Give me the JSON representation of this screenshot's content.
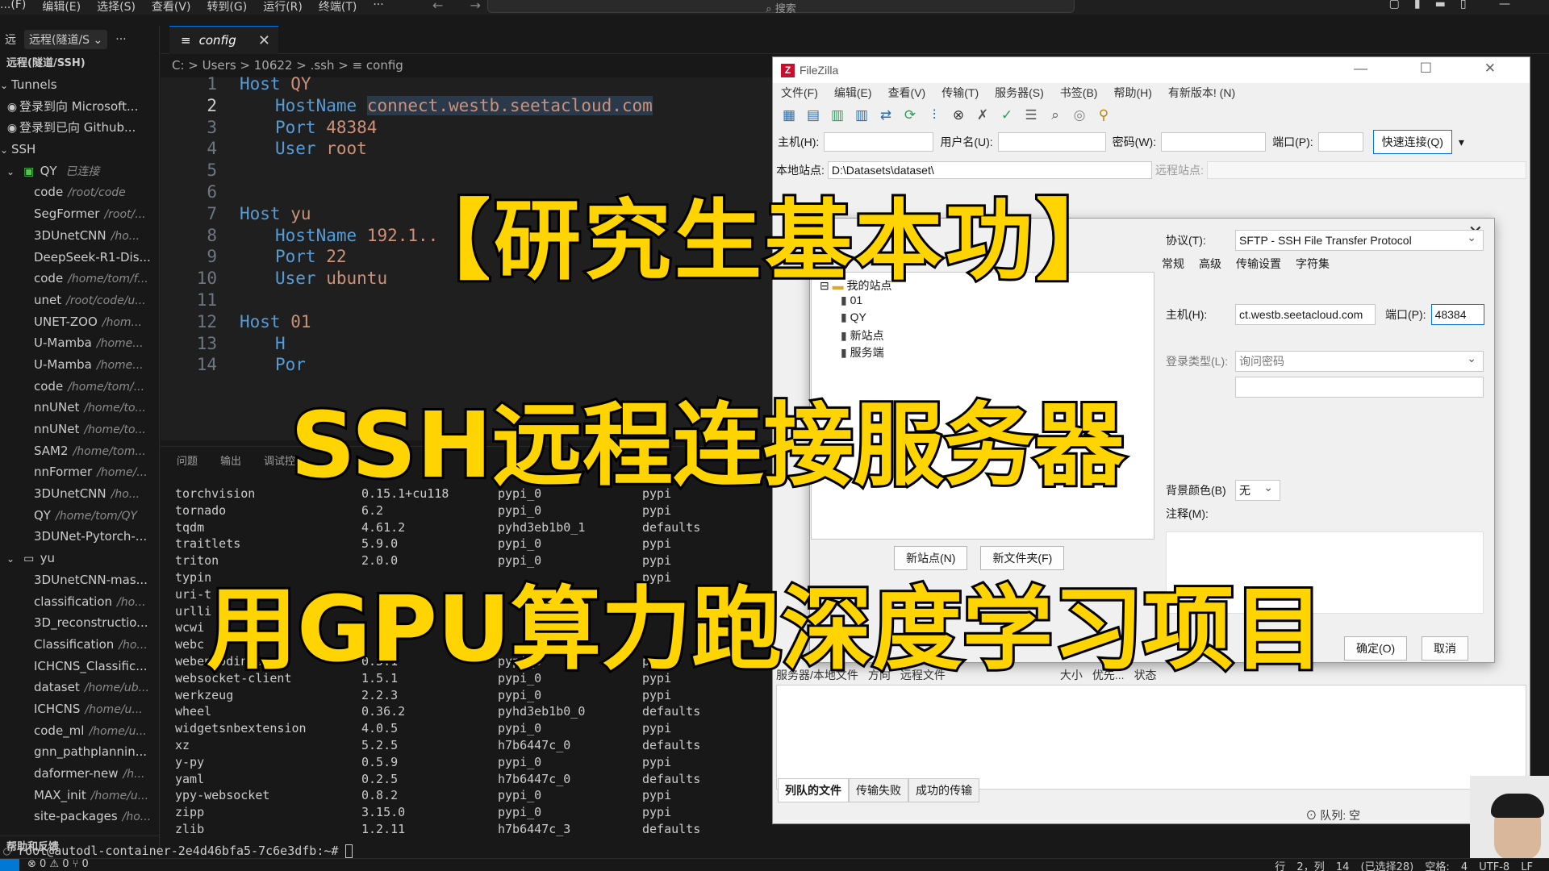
{
  "vscode": {
    "menu": [
      "...(F)",
      "编辑(E)",
      "选择(S)",
      "查看(V)",
      "转到(G)",
      "运行(R)",
      "终端(T)",
      "···"
    ],
    "search_placeholder": "⌕ 搜索",
    "sidebar_header_short": "远",
    "sidebar_dropdown": "远程(隧道/S ⌄",
    "sidebar_more": "···",
    "section_title": "远程(隧道/SSH)",
    "tunnels_label": "Tunnels",
    "tunnel_items": [
      "登录到向 Microsoft...",
      "登录到已向 Github..."
    ],
    "ssh_label": "SSH",
    "host_qy": {
      "name": "QY",
      "status": "已连接"
    },
    "qy_items": [
      {
        "name": "code",
        "path": "/root/code"
      },
      {
        "name": "SegFormer",
        "path": "/root/..."
      },
      {
        "name": "3DUnetCNN",
        "path": "/ho..."
      },
      {
        "name": "DeepSeek-R1-Dis...",
        "path": ""
      },
      {
        "name": "code",
        "path": "/home/tom/f..."
      },
      {
        "name": "unet",
        "path": "/root/code/u..."
      },
      {
        "name": "UNET-ZOO",
        "path": "/hom..."
      },
      {
        "name": "U-Mamba",
        "path": "/home..."
      },
      {
        "name": "U-Mamba",
        "path": "/home..."
      },
      {
        "name": "code",
        "path": "/home/tom/..."
      },
      {
        "name": "nnUNet",
        "path": "/home/to..."
      },
      {
        "name": "nnUNet",
        "path": "/home/to..."
      },
      {
        "name": "SAM2",
        "path": "/home/tom..."
      },
      {
        "name": "nnFormer",
        "path": "/home/..."
      },
      {
        "name": "3DUnetCNN",
        "path": "/ho..."
      },
      {
        "name": "QY",
        "path": "/home/tom/QY"
      },
      {
        "name": "3DUNet-Pytorch-...",
        "path": ""
      }
    ],
    "host_yu": {
      "name": "yu"
    },
    "yu_items": [
      {
        "name": "3DUnetCNN-mas...",
        "path": ""
      },
      {
        "name": "classification",
        "path": "/ho..."
      },
      {
        "name": "3D_reconstructio...",
        "path": ""
      },
      {
        "name": "Classification",
        "path": "/ho..."
      },
      {
        "name": "ICHCNS_Classific...",
        "path": ""
      },
      {
        "name": "dataset",
        "path": "/home/ub..."
      },
      {
        "name": "ICHCNS",
        "path": "/home/u..."
      },
      {
        "name": "code_ml",
        "path": "/home/u..."
      },
      {
        "name": "gnn_pathplannin...",
        "path": ""
      },
      {
        "name": "daformer-new",
        "path": "/h..."
      },
      {
        "name": "MAX_init",
        "path": "/home/u..."
      },
      {
        "name": "site-packages",
        "path": "/ho..."
      }
    ],
    "sidebar_footer": "帮助和反馈",
    "tab_label": "config",
    "breadcrumb": "C: > Users > 10622 > .ssh > ≡ config",
    "code_lines": [
      {
        "n": "1",
        "key": "Host",
        "val": "QY",
        "indent": false
      },
      {
        "n": "2",
        "key": "HostName",
        "val": "connect.westb.seetacloud.com",
        "indent": true
      },
      {
        "n": "3",
        "key": "Port",
        "val": "48384",
        "indent": true
      },
      {
        "n": "4",
        "key": "User",
        "val": "root",
        "indent": true
      },
      {
        "n": "5",
        "key": "",
        "val": "",
        "indent": false
      },
      {
        "n": "6",
        "key": "",
        "val": "",
        "indent": false
      },
      {
        "n": "7",
        "key": "Host",
        "val": "yu",
        "indent": false
      },
      {
        "n": "8",
        "key": "HostName",
        "val": "192.1..",
        "indent": true
      },
      {
        "n": "9",
        "key": "Port",
        "val": "22",
        "indent": true
      },
      {
        "n": "10",
        "key": "User",
        "val": "ubuntu",
        "indent": true
      },
      {
        "n": "11",
        "key": "",
        "val": "",
        "indent": false
      },
      {
        "n": "12",
        "key": "Host",
        "val": "01",
        "indent": false
      },
      {
        "n": "13",
        "key": "H",
        "val": "",
        "indent": true
      },
      {
        "n": "14",
        "key": "Por",
        "val": "",
        "indent": true
      }
    ],
    "panel_tabs": [
      "问题",
      "输出",
      "调试控"
    ],
    "terminal_rows": [
      [
        "torchvision",
        "0.15.1+cu118",
        "pypi_0",
        "pypi"
      ],
      [
        "tornado",
        "6.2",
        "pypi_0",
        "pypi"
      ],
      [
        "tqdm",
        "4.61.2",
        "pyhd3eb1b0_1",
        "defaults"
      ],
      [
        "traitlets",
        "5.9.0",
        "pypi_0",
        "pypi"
      ],
      [
        "triton",
        "2.0.0",
        "pypi_0",
        "pypi"
      ],
      [
        "typin",
        "",
        "",
        "pypi"
      ],
      [
        "uri-t",
        "",
        "",
        ""
      ],
      [
        "urlli",
        "",
        "",
        ""
      ],
      [
        "wcwi",
        "",
        "",
        ""
      ],
      [
        "webc",
        "",
        "",
        ""
      ],
      [
        "webencodings",
        "0.5.1",
        "pypi_0",
        "pypi"
      ],
      [
        "websocket-client",
        "1.5.1",
        "pypi_0",
        "pypi"
      ],
      [
        "werkzeug",
        "2.2.3",
        "pypi_0",
        "pypi"
      ],
      [
        "wheel",
        "0.36.2",
        "pyhd3eb1b0_0",
        "defaults"
      ],
      [
        "widgetsnbextension",
        "4.0.5",
        "pypi_0",
        "pypi"
      ],
      [
        "xz",
        "5.2.5",
        "h7b6447c_0",
        "defaults"
      ],
      [
        "y-py",
        "0.5.9",
        "pypi_0",
        "pypi"
      ],
      [
        "yaml",
        "0.2.5",
        "h7b6447c_0",
        "defaults"
      ],
      [
        "ypy-websocket",
        "0.8.2",
        "pypi_0",
        "pypi"
      ],
      [
        "zipp",
        "3.15.0",
        "pypi_0",
        "pypi"
      ],
      [
        "zlib",
        "1.2.11",
        "h7b6447c_3",
        "defaults"
      ]
    ],
    "prompt": "root@autodl-container-2e4d46bfa5-7c6e3dfb:~#",
    "status_left": "⊗ 0 ⚠ 0   ⑂ 0",
    "status_right": "行 2，列 14 (已选择28)  空格: 4  UTF-8  LF"
  },
  "filezilla": {
    "title": "FileZilla",
    "logo_letter": "Z",
    "menu": [
      "文件(F)",
      "编辑(E)",
      "查看(V)",
      "传输(T)",
      "服务器(S)",
      "书签(B)",
      "帮助(H)",
      "有新版本! (N)"
    ],
    "host_label": "主机(H):",
    "user_label": "用户名(U):",
    "pass_label": "密码(W):",
    "port_label": "端口(P):",
    "quickconnect": "快速连接(Q)",
    "local_site_label": "本地站点:",
    "local_path": "D:\\Datasets\\dataset\\",
    "remote_site_label": "远程站点:",
    "queue_cols": [
      "服务器/本地文件",
      "方向",
      "远程文件",
      "大小",
      "优先...",
      "状态"
    ],
    "queue_tabs": [
      "列队的文件",
      "传输失败",
      "成功的传输"
    ],
    "queue_status": "队列: 空",
    "site_manager": {
      "tree_root": "我的站点",
      "sites": [
        "01",
        "QY",
        "新站点",
        "服务端"
      ],
      "new_site": "新站点(N)",
      "new_folder": "新文件夹(F)",
      "tabs": [
        "常规",
        "高级",
        "传输设置",
        "字符集"
      ],
      "protocol_label": "协议(T):",
      "protocol_value": "SFTP - SSH File Transfer Protocol",
      "host_label": "主机(H):",
      "host_value": "ct.westb.seetacloud.com",
      "port_label": "端口(P):",
      "port_value": "48384",
      "logon_label": "登录类型(L):",
      "logon_value": "询问密码",
      "bgcolor_label": "背景颜色(B)",
      "bgcolor_value": "无",
      "notes_label": "注释(M):",
      "ok": "确定(O)",
      "cancel": "取消"
    }
  },
  "overlay": {
    "line1": "【研究生基本功】",
    "line2": "SSH远程连接服务器",
    "line3": "用GPU算力跑深度学习项目"
  }
}
